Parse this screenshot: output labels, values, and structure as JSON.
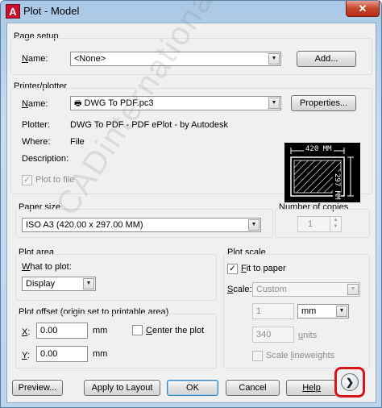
{
  "window": {
    "title": "Plot - Model",
    "app_icon_glyph": "A",
    "close_glyph": "✕"
  },
  "page_setup": {
    "title": "Page setup",
    "name_label": "Name:",
    "name_value": "<None>",
    "add_button": "Add..."
  },
  "printer": {
    "title": "Printer/plotter",
    "name_label": "Name:",
    "name_value": "DWG To PDF.pc3",
    "properties_button": "Properties...",
    "plotter_label": "Plotter:",
    "plotter_value": "DWG To PDF - PDF ePlot - by Autodesk",
    "where_label": "Where:",
    "where_value": "File",
    "description_label": "Description:",
    "plot_to_file_label": "Plot to file",
    "plot_to_file_checked": true,
    "preview_width": "420 MM",
    "preview_height": "297 MM"
  },
  "paper_size": {
    "title": "Paper size",
    "value": "ISO A3 (420.00 x 297.00 MM)"
  },
  "copies": {
    "title": "Number of copies",
    "value": "1"
  },
  "plot_area": {
    "title": "Plot area",
    "what_label": "What to plot:",
    "what_value": "Display"
  },
  "plot_scale": {
    "title": "Plot scale",
    "fit_label": "Fit to paper",
    "fit_checked": true,
    "scale_label": "Scale:",
    "scale_value": "Custom",
    "value1": "1",
    "unit1": "mm",
    "value2": "340",
    "unit2": "units",
    "lineweights_label": "Scale lineweights"
  },
  "plot_offset": {
    "title": "Plot offset (origin set to printable area)",
    "x_label": "X:",
    "x_value": "0.00",
    "x_unit": "mm",
    "y_label": "Y:",
    "y_value": "0.00",
    "y_unit": "mm",
    "center_label": "Center the plot"
  },
  "buttons": {
    "preview": "Preview...",
    "apply": "Apply to Layout",
    "ok": "OK",
    "cancel": "Cancel",
    "help": "Help",
    "expand_glyph": "❯"
  },
  "watermark": "CADinternational.com"
}
